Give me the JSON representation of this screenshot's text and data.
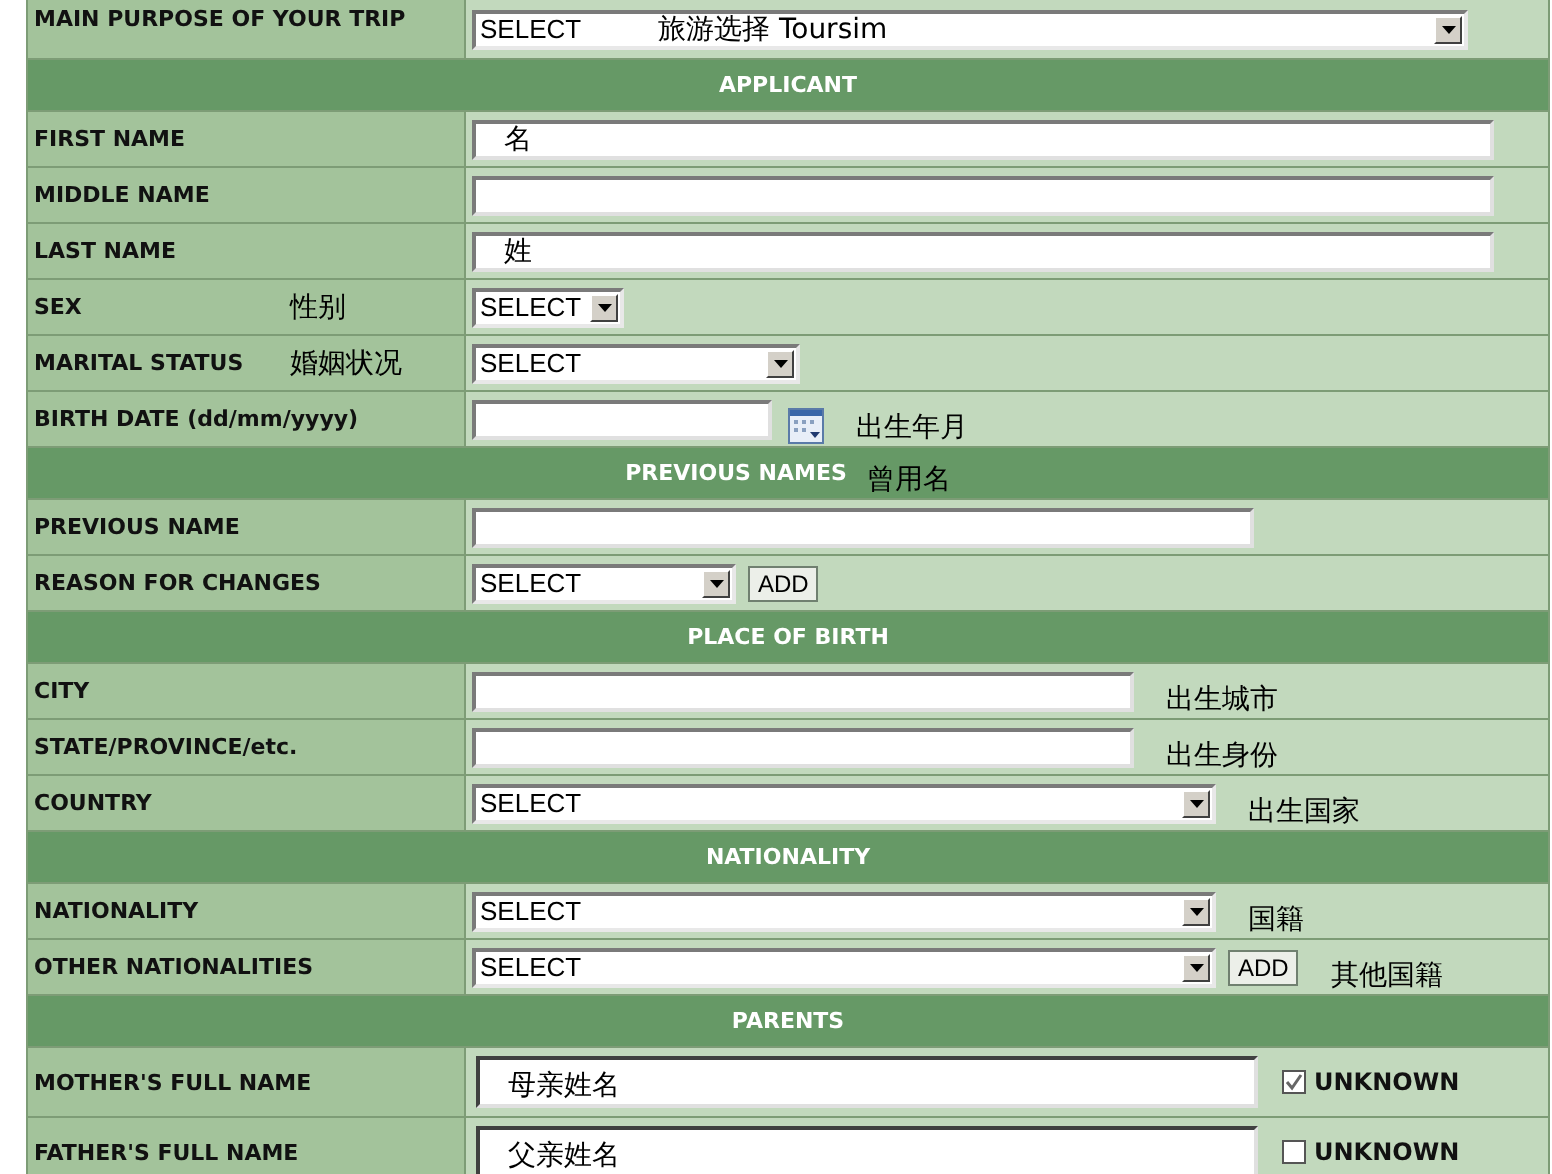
{
  "rows": [
    {
      "kind": "field",
      "label": "MAIN PURPOSE OF YOUR TRIP",
      "control": {
        "kind": "select",
        "value": "SELECT"
      },
      "note": "旅游选择 Toursim",
      "note_inside": true
    },
    {
      "kind": "section",
      "title": "APPLICANT"
    },
    {
      "kind": "field",
      "label": "FIRST NAME",
      "control": {
        "kind": "text",
        "value": "名"
      }
    },
    {
      "kind": "field",
      "label": "MIDDLE NAME",
      "control": {
        "kind": "text"
      }
    },
    {
      "kind": "field",
      "label": "LAST NAME",
      "control": {
        "kind": "text",
        "value": "姓"
      }
    },
    {
      "kind": "field",
      "label": "SEX",
      "label_note": "性别",
      "control": {
        "kind": "select",
        "value": "SELECT"
      }
    },
    {
      "kind": "field",
      "label": "MARITAL STATUS",
      "label_note": "婚姻状况",
      "control": {
        "kind": "select",
        "value": "SELECT"
      }
    },
    {
      "kind": "field",
      "label": "BIRTH DATE (dd/mm/yyyy)",
      "control": {
        "kind": "date"
      },
      "note": "出生年月",
      "note_inside": false
    },
    {
      "kind": "section",
      "title": "PREVIOUS NAMES",
      "note": "曾用名"
    },
    {
      "kind": "field",
      "label": "PREVIOUS NAME",
      "control": {
        "kind": "text"
      }
    },
    {
      "kind": "field",
      "label": "REASON FOR CHANGES",
      "control": {
        "kind": "select",
        "value": "SELECT"
      },
      "button": "ADD"
    },
    {
      "kind": "section",
      "title": "PLACE OF BIRTH"
    },
    {
      "kind": "field",
      "label": "CITY",
      "control": {
        "kind": "text"
      },
      "note": "出生城市",
      "note_inside": false
    },
    {
      "kind": "field",
      "label": "STATE/PROVINCE/etc.",
      "control": {
        "kind": "text"
      },
      "note": "出生身份",
      "note_inside": false
    },
    {
      "kind": "field",
      "label": "COUNTRY",
      "control": {
        "kind": "select",
        "value": "SELECT"
      },
      "note": "出生国家",
      "note_inside": false
    },
    {
      "kind": "section",
      "title": "NATIONALITY"
    },
    {
      "kind": "field",
      "label": "NATIONALITY",
      "control": {
        "kind": "select",
        "value": "SELECT"
      },
      "note": "国籍",
      "note_inside": false
    },
    {
      "kind": "field",
      "label": "OTHER NATIONALITIES",
      "control": {
        "kind": "select",
        "value": "SELECT"
      },
      "button": "ADD",
      "note": "其他国籍",
      "note_inside": false
    },
    {
      "kind": "section",
      "title": "PARENTS"
    },
    {
      "kind": "field",
      "label": "MOTHER'S FULL NAME",
      "control": {
        "kind": "name",
        "value": "母亲姓名"
      },
      "checkbox": {
        "label": "UNKNOWN",
        "checked": true
      }
    },
    {
      "kind": "field",
      "label": "FATHER'S FULL NAME",
      "control": {
        "kind": "name",
        "value": "父亲姓名"
      },
      "checkbox": {
        "label": "UNKNOWN",
        "checked": false
      }
    }
  ]
}
